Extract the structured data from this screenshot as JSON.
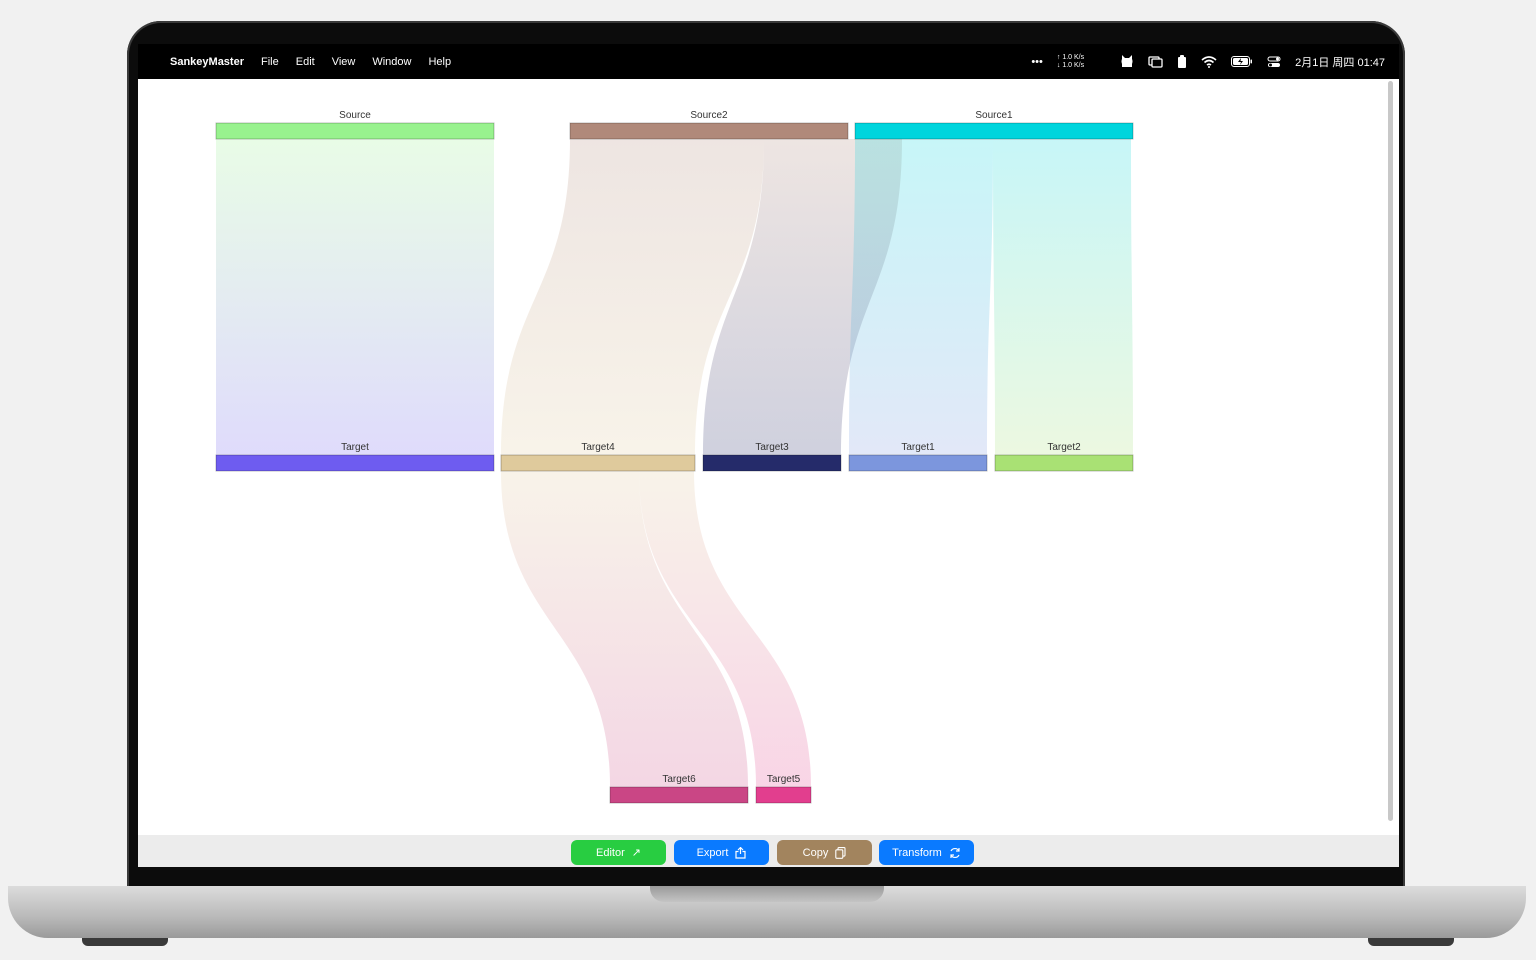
{
  "menubar": {
    "app_name": "SankeyMaster",
    "menus": [
      "File",
      "Edit",
      "View",
      "Window",
      "Help"
    ],
    "ellipsis": "•••",
    "net_up": "↑ 1.0 K/s",
    "net_down": "↓ 1.0 K/s",
    "clock": "2月1日 周四 01:47"
  },
  "toolbar": {
    "editor_label": "Editor",
    "export_label": "Export",
    "copy_label": "Copy",
    "transform_label": "Transform"
  },
  "colors": {
    "editor": "#28cd41",
    "export": "#0a7aff",
    "copy": "#a2845e",
    "transform": "#0a7aff"
  },
  "sankey": {
    "nodes": [
      {
        "id": "source",
        "label": "Source",
        "color": "#98f28e"
      },
      {
        "id": "source2",
        "label": "Source2",
        "color": "#b0897a"
      },
      {
        "id": "source1",
        "label": "Source1",
        "color": "#00d5dd"
      },
      {
        "id": "target",
        "label": "Target",
        "color": "#6e5cf0"
      },
      {
        "id": "target4",
        "label": "Target4",
        "color": "#dfca9c"
      },
      {
        "id": "target3",
        "label": "Target3",
        "color": "#252b6a"
      },
      {
        "id": "target1",
        "label": "Target1",
        "color": "#7c96dd"
      },
      {
        "id": "target2",
        "label": "Target2",
        "color": "#a9e174"
      },
      {
        "id": "target6",
        "label": "Target6",
        "color": "#ca4685"
      },
      {
        "id": "target5",
        "label": "Target5",
        "color": "#e23e8e"
      }
    ],
    "links": [
      {
        "source": "source",
        "target": "target"
      },
      {
        "source": "source2",
        "target": "target4"
      },
      {
        "source": "source2",
        "target": "target3"
      },
      {
        "source": "source1",
        "target": "target1"
      },
      {
        "source": "source1",
        "target": "target2"
      },
      {
        "source": "target4",
        "target": "target6"
      },
      {
        "source": "target4",
        "target": "target5"
      }
    ]
  }
}
